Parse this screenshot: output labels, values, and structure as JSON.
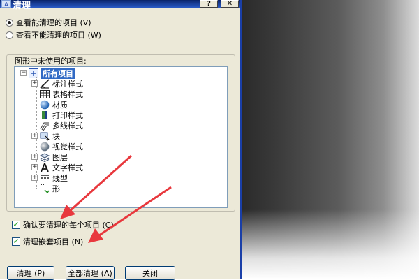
{
  "window": {
    "title": "清理",
    "app_icon_text": "A",
    "help_button": "?",
    "close_button": "✕"
  },
  "view_options": [
    {
      "label": "查看能清理的项目 (V)",
      "checked": true
    },
    {
      "label": "查看不能清理的项目 (W)",
      "checked": false
    }
  ],
  "tree_group": {
    "label": "图形中未使用的项目:",
    "root": {
      "label": "所有项目",
      "expander": "−"
    },
    "items": [
      {
        "label": "标注样式",
        "expander": "+",
        "icon": "dimension-style-icon"
      },
      {
        "label": "表格样式",
        "expander": "",
        "icon": "table-style-icon"
      },
      {
        "label": "材质",
        "expander": "",
        "icon": "material-sphere-icon"
      },
      {
        "label": "打印样式",
        "expander": "",
        "icon": "plot-style-icon"
      },
      {
        "label": "多线样式",
        "expander": "",
        "icon": "multiline-style-icon"
      },
      {
        "label": "块",
        "expander": "+",
        "icon": "block-icon"
      },
      {
        "label": "视觉样式",
        "expander": "",
        "icon": "visual-style-icon"
      },
      {
        "label": "图层",
        "expander": "+",
        "icon": "layer-icon"
      },
      {
        "label": "文字样式",
        "expander": "+",
        "icon": "text-style-icon"
      },
      {
        "label": "线型",
        "expander": "+",
        "icon": "linetype-icon"
      },
      {
        "label": "形",
        "expander": "",
        "icon": "shape-icon"
      }
    ]
  },
  "options": [
    {
      "label": "确认要清理的每个项目 (C)",
      "checked": true
    },
    {
      "label": "清理嵌套项目 (N)",
      "checked": true
    }
  ],
  "buttons": {
    "purge": "清理 (P)",
    "purge_all": "全部清理 (A)",
    "close": "关闭"
  },
  "colors": {
    "arrow": "#e8383d",
    "selection": "#316ac5",
    "titlebar": "#0a246a"
  }
}
